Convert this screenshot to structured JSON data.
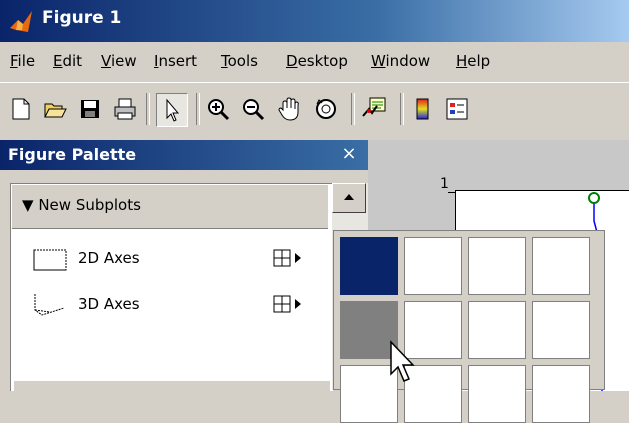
{
  "window": {
    "title": "Figure 1"
  },
  "menu": [
    "File",
    "Edit",
    "View",
    "Insert",
    "Tools",
    "Desktop",
    "Window",
    "Help"
  ],
  "menu_mnemonics": [
    "F",
    "E",
    "V",
    "I",
    "T",
    "D",
    "W",
    "H"
  ],
  "toolbar": {
    "icons": [
      "new-file-icon",
      "open-folder-icon",
      "save-icon",
      "print-icon",
      "pointer-icon",
      "zoom-in-icon",
      "zoom-out-icon",
      "pan-hand-icon",
      "rotate-3d-icon",
      "data-cursor-icon",
      "colorbar-icon",
      "legend-icon"
    ]
  },
  "palette": {
    "title": "Figure Palette",
    "close": "×",
    "section": "New Subplots",
    "items": [
      {
        "label": "2D Axes",
        "icon": "axes-2d-icon"
      },
      {
        "label": "3D Axes",
        "icon": "axes-3d-icon"
      }
    ]
  },
  "axes": {
    "ytick_top": "1"
  },
  "subplot_grid": {
    "rows": 3,
    "cols": 4,
    "selected": [
      [
        0,
        0
      ]
    ],
    "hover": [
      [
        1,
        0
      ]
    ]
  },
  "colors": {
    "accent": "#0a246a",
    "chrome": "#d4d0c8",
    "line": "#0000ff",
    "marker": "#008000"
  }
}
